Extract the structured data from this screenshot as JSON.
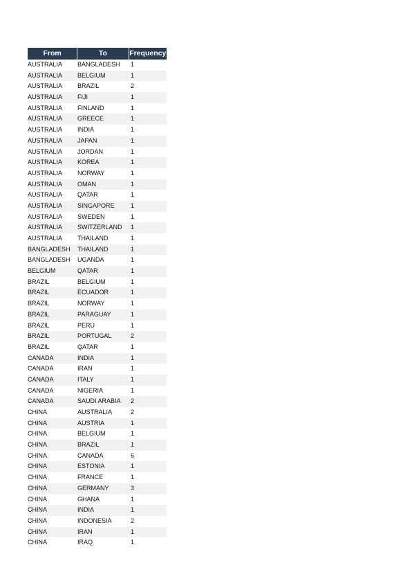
{
  "table": {
    "headers": {
      "from": "From",
      "to": "To",
      "frequency": "Frequency"
    },
    "rows": [
      [
        "AUSTRALIA",
        "BANGLADESH",
        "1"
      ],
      [
        "AUSTRALIA",
        "BELGIUM",
        "1"
      ],
      [
        "AUSTRALIA",
        "BRAZIL",
        "2"
      ],
      [
        "AUSTRALIA",
        "FIJI",
        "1"
      ],
      [
        "AUSTRALIA",
        "FINLAND",
        "1"
      ],
      [
        "AUSTRALIA",
        "GREECE",
        "1"
      ],
      [
        "AUSTRALIA",
        "INDIA",
        "1"
      ],
      [
        "AUSTRALIA",
        "JAPAN",
        "1"
      ],
      [
        "AUSTRALIA",
        "JORDAN",
        "1"
      ],
      [
        "AUSTRALIA",
        "KOREA",
        "1"
      ],
      [
        "AUSTRALIA",
        "NORWAY",
        "1"
      ],
      [
        "AUSTRALIA",
        "OMAN",
        "1"
      ],
      [
        "AUSTRALIA",
        "QATAR",
        "1"
      ],
      [
        "AUSTRALIA",
        "SINGAPORE",
        "1"
      ],
      [
        "AUSTRALIA",
        "SWEDEN",
        "1"
      ],
      [
        "AUSTRALIA",
        "SWITZERLAND",
        "1"
      ],
      [
        "AUSTRALIA",
        "THAILAND",
        "1"
      ],
      [
        "BANGLADESH",
        "THAILAND",
        "1"
      ],
      [
        "BANGLADESH",
        "UGANDA",
        "1"
      ],
      [
        "BELGIUM",
        "QATAR",
        "1"
      ],
      [
        "BRAZIL",
        "BELGIUM",
        "1"
      ],
      [
        "BRAZIL",
        "ECUADOR",
        "1"
      ],
      [
        "BRAZIL",
        "NORWAY",
        "1"
      ],
      [
        "BRAZIL",
        "PARAGUAY",
        "1"
      ],
      [
        "BRAZIL",
        "PERU",
        "1"
      ],
      [
        "BRAZIL",
        "PORTUGAL",
        "2"
      ],
      [
        "BRAZIL",
        "QATAR",
        "1"
      ],
      [
        "CANADA",
        "INDIA",
        "1"
      ],
      [
        "CANADA",
        "IRAN",
        "1"
      ],
      [
        "CANADA",
        "ITALY",
        "1"
      ],
      [
        "CANADA",
        "NIGERIA",
        "1"
      ],
      [
        "CANADA",
        "SAUDI ARABIA",
        "2"
      ],
      [
        "CHINA",
        "AUSTRALIA",
        "2"
      ],
      [
        "CHINA",
        "AUSTRIA",
        "1"
      ],
      [
        "CHINA",
        "BELGIUM",
        "1"
      ],
      [
        "CHINA",
        "BRAZIL",
        "1"
      ],
      [
        "CHINA",
        "CANADA",
        "6"
      ],
      [
        "CHINA",
        "ESTONIA",
        "1"
      ],
      [
        "CHINA",
        "FRANCE",
        "1"
      ],
      [
        "CHINA",
        "GERMANY",
        "3"
      ],
      [
        "CHINA",
        "GHANA",
        "1"
      ],
      [
        "CHINA",
        "INDIA",
        "1"
      ],
      [
        "CHINA",
        "INDONESIA",
        "2"
      ],
      [
        "CHINA",
        "IRAN",
        "1"
      ],
      [
        "CHINA",
        "IRAQ",
        "1"
      ]
    ]
  },
  "colors": {
    "header_bg": "#2b3b52",
    "header_text": "#ffffff",
    "stripe": "#f2f2f2"
  }
}
